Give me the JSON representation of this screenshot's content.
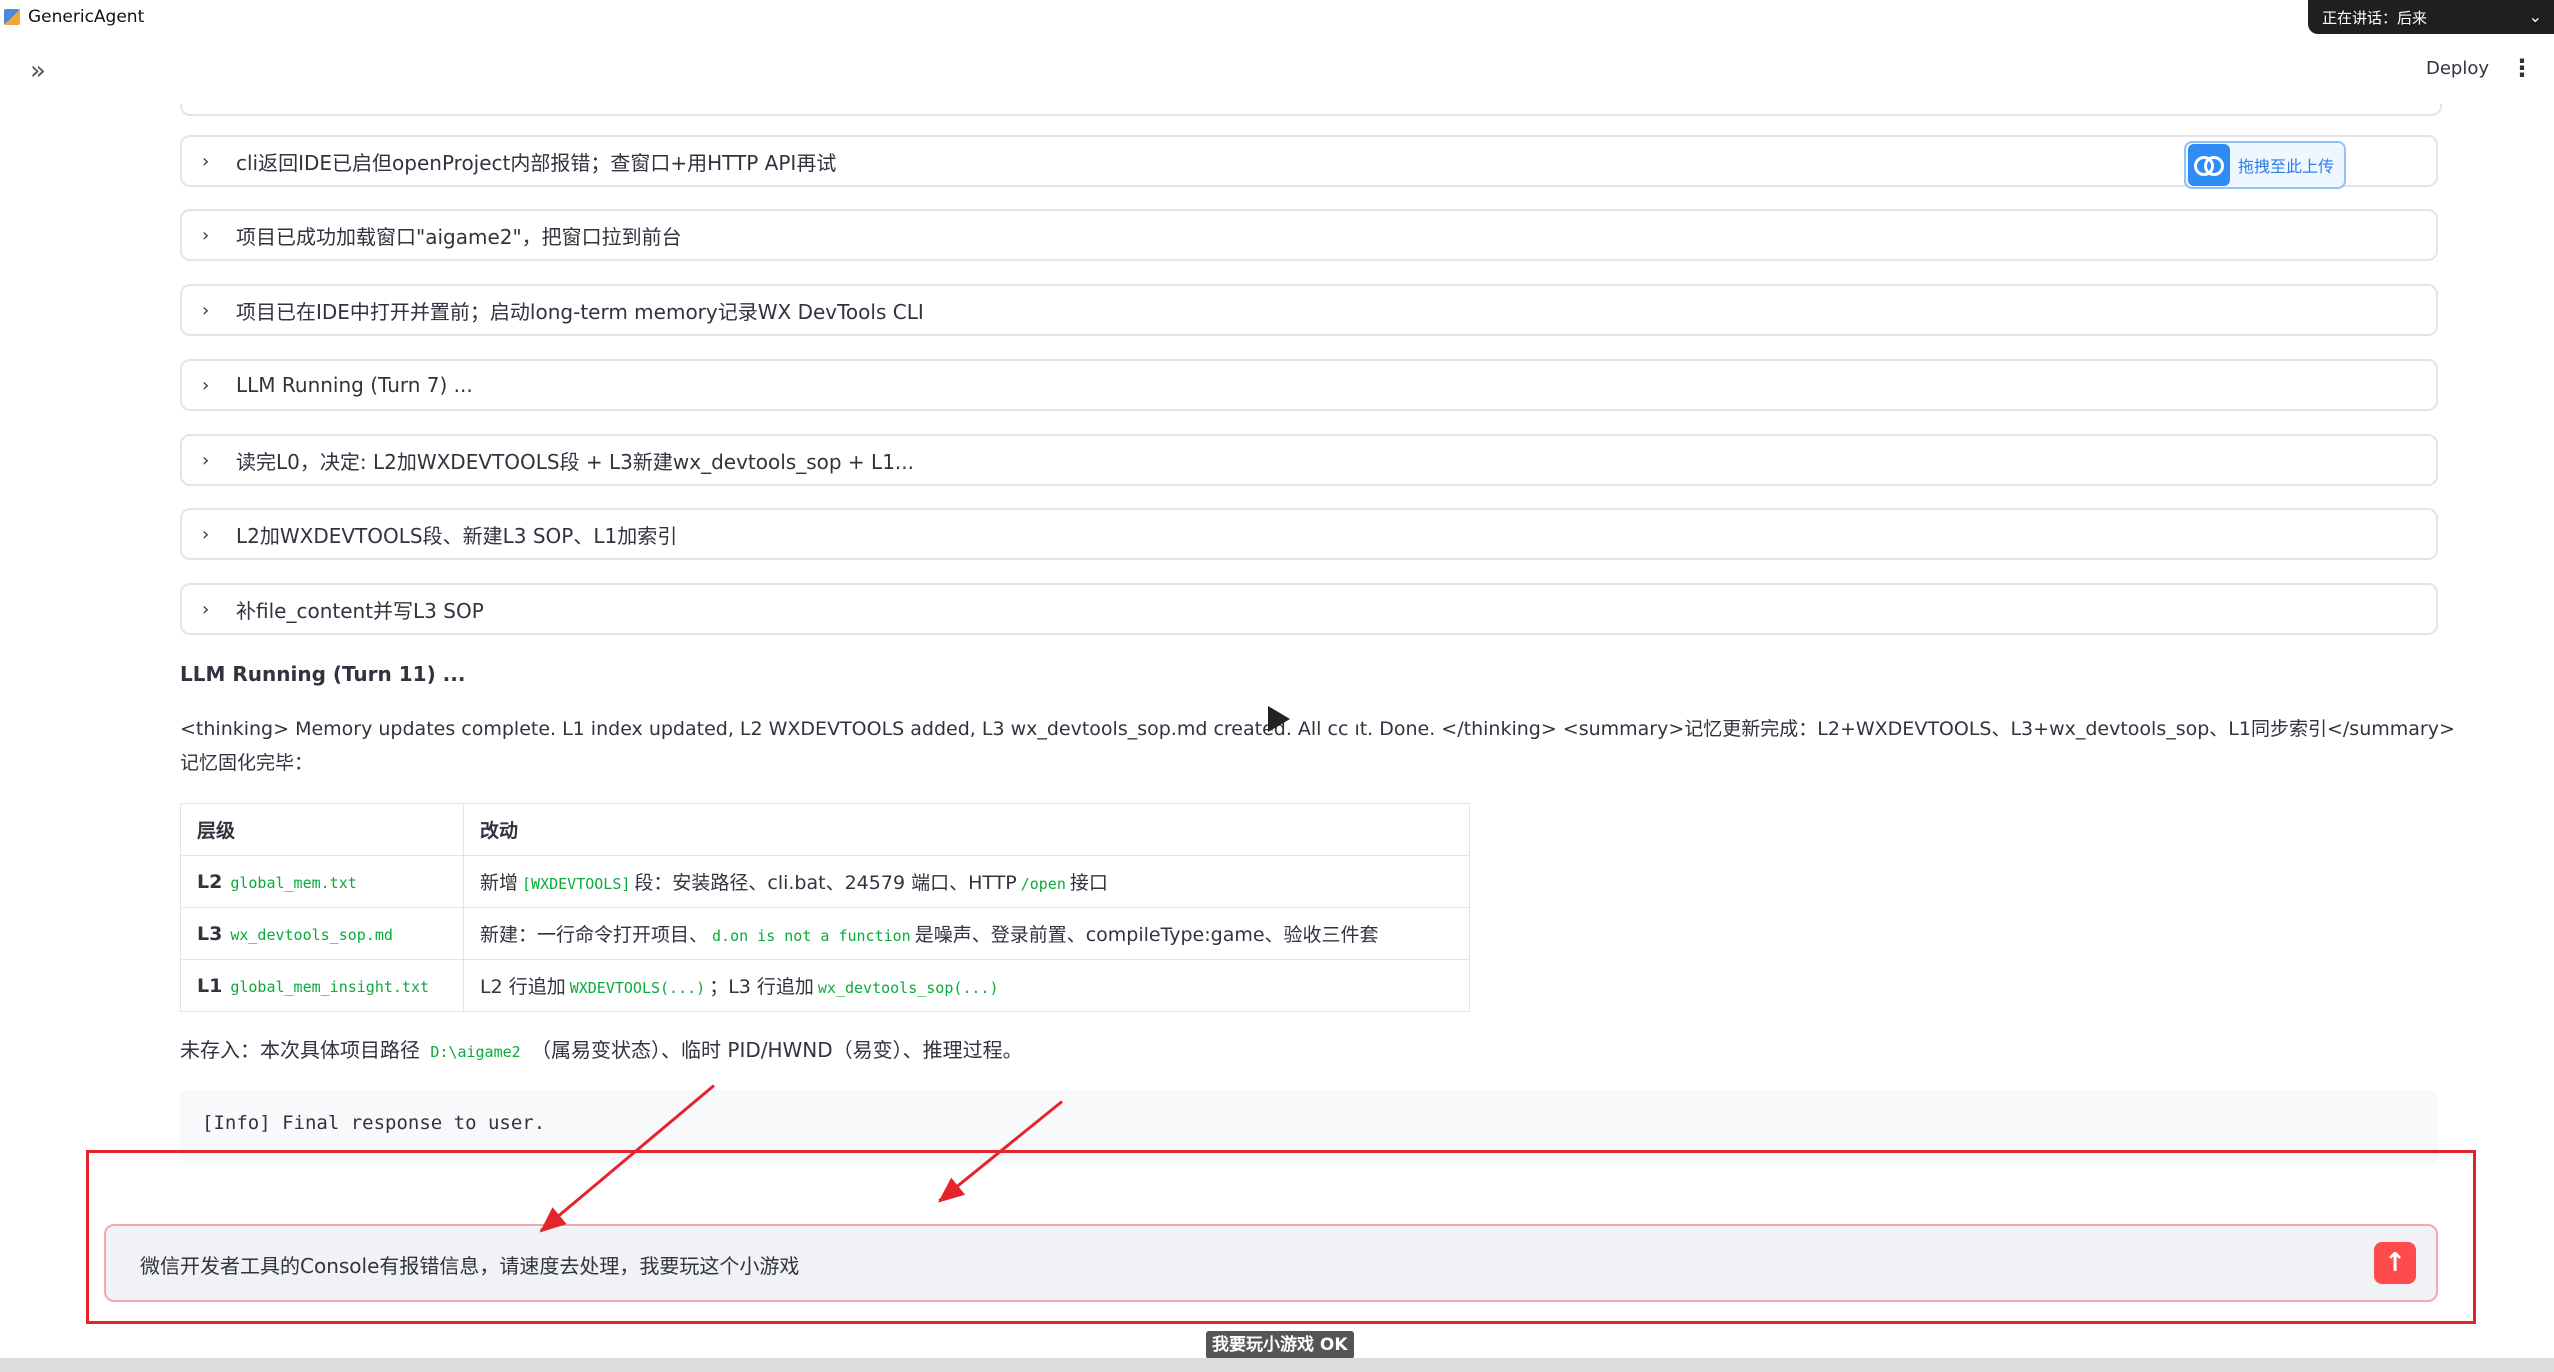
{
  "window": {
    "title": "GenericAgent"
  },
  "speaking_indicator": {
    "text": "正在讲话：后来",
    "chevron": "chevron-down-icon"
  },
  "header": {
    "deploy_label": "Deploy",
    "menu_icon": "⋮",
    "sidebar_toggle": "»"
  },
  "upload": {
    "label": "拖拽至此上传"
  },
  "expanders": [
    {
      "label": "cli返回IDE已启但openProject内部报错；查窗口+用HTTP API再试"
    },
    {
      "label": "项目已成功加载窗口\"aigame2\"，把窗口拉到前台"
    },
    {
      "label": "项目已在IDE中打开并置前；启动long-term memory记录WX DevTools CLI"
    },
    {
      "label": "LLM Running (Turn 7) ..."
    },
    {
      "label": "读完L0，决定: L2加WXDEVTOOLS段 + L3新建wx_devtools_sop + L1..."
    },
    {
      "label": "L2加WXDEVTOOLS段、新建L3 SOP、L1加索引"
    },
    {
      "label": "补file_content并写L3 SOP"
    }
  ],
  "turn": {
    "heading": "LLM Running (Turn 11) ...",
    "para_line1": "<thinking> Memory updates complete. L1 index updated, L2 WXDEVTOOLS added, L3 wx_devtools_sop.md created. All cc        ıt. Done. </thinking> <summary>记忆更新完成：L2+WXDEVTOOLS、L3+wx_devtools_sop、L1同步索引</summary>",
    "para_line2": "记忆固化完毕："
  },
  "memory_table": {
    "headers": [
      "层级",
      "改动"
    ],
    "rows": [
      {
        "level": "L2",
        "file": "global_mem.txt",
        "c1": "新增",
        "code1": "[WXDEVTOOLS]",
        "c2": "段：安装路径、cli.bat、24579 端口、HTTP",
        "code2": "/open",
        "c3": "接口"
      },
      {
        "level": "L3",
        "file": "wx_devtools_sop.md",
        "c1": "新建：一行命令打开项目、",
        "code1": "d.on is not a function",
        "c2": "是噪声、登录前置、compileType:game、验收三件套",
        "code2": "",
        "c3": ""
      },
      {
        "level": "L1",
        "file": "global_mem_insight.txt",
        "c1": "L2 行追加",
        "code1": "WXDEVTOOLS(...)",
        "c2": "；L3 行追加",
        "code2": "wx_devtools_sop(...)",
        "c3": ""
      }
    ]
  },
  "not_saved": {
    "prefix": "未存入：本次具体项目路径",
    "path": "D:\\aigame2",
    "suffix": "（属易变状态）、临时 PID/HWND（易变）、推理过程。"
  },
  "info": {
    "text": "[Info] Final response to user."
  },
  "chat": {
    "value": "微信开发者工具的Console有报错信息，请速度去处理，我要玩这个小游戏",
    "send_icon": "↑"
  },
  "toast": {
    "text": "我要玩小游戏 OK"
  },
  "colors": {
    "accent": "#ff4b4b",
    "annotation_red": "#e5232a",
    "code_green": "#09ab3b"
  }
}
